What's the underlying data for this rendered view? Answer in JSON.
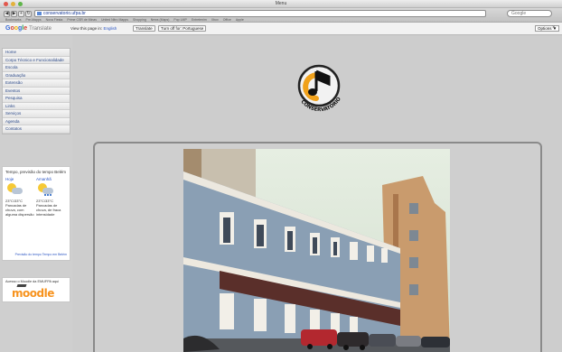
{
  "window": {
    "title": "Menu"
  },
  "toolbar": {
    "nav": [
      "◀",
      "▶",
      "+",
      "↻"
    ],
    "address": "conservatorio.ufpa.br",
    "google_search": "Google",
    "bookmarks": [
      "Bookmarks",
      "Pre-Mapps",
      "Nova Fiesta",
      "Prime CSR de Minas",
      "United Nitro Mapps",
      "Shopping",
      "News (Maps)",
      "Pop LMP",
      "Entretenim",
      "Xbox",
      "Office",
      "Apple"
    ]
  },
  "translate": {
    "brand_g": "G",
    "brand_o1": "o",
    "brand_o2": "o",
    "brand_g2": "g",
    "brand_l": "l",
    "brand_e": "e",
    "brand_product": "Translate",
    "view_prefix": "View this page in:",
    "language": "English",
    "translate_button": "Translate",
    "turn_off_button": "Turn off for: Portuguese",
    "options": "Options ▼",
    "close": "×"
  },
  "sidebar": {
    "menu": [
      "Home",
      "Corpo Técnico e Funcionalidade",
      "Escola",
      "Graduação",
      "Extensão",
      "Eventos",
      "Pesquisa",
      "Links",
      "Serviços",
      "Agenda",
      "Contatos"
    ],
    "weather": {
      "title": "Tempo, previsão do tempo Belém",
      "today_city": "Hoje",
      "today_text": "23°C/33°C Pancadas de chuva, com alguma dispersão",
      "tomorrow_city": "Amanhã",
      "tomorrow_text": "23°C/33°C Pancadas de chuva, de fraca intensidade",
      "link": "Previsão do tempo Tempo em Belém"
    },
    "moodle": {
      "caption": "Acesso o Moodle da EMUFPA aqui",
      "logo": "moodle"
    }
  },
  "main": {
    "logo_text": "CONSERVATÓRIO",
    "photo_alt": "Fachada do prédio"
  },
  "colors": {
    "accent": "#2c4a8a",
    "moodle": "#f7931e",
    "frame": "#8a8a8a"
  }
}
